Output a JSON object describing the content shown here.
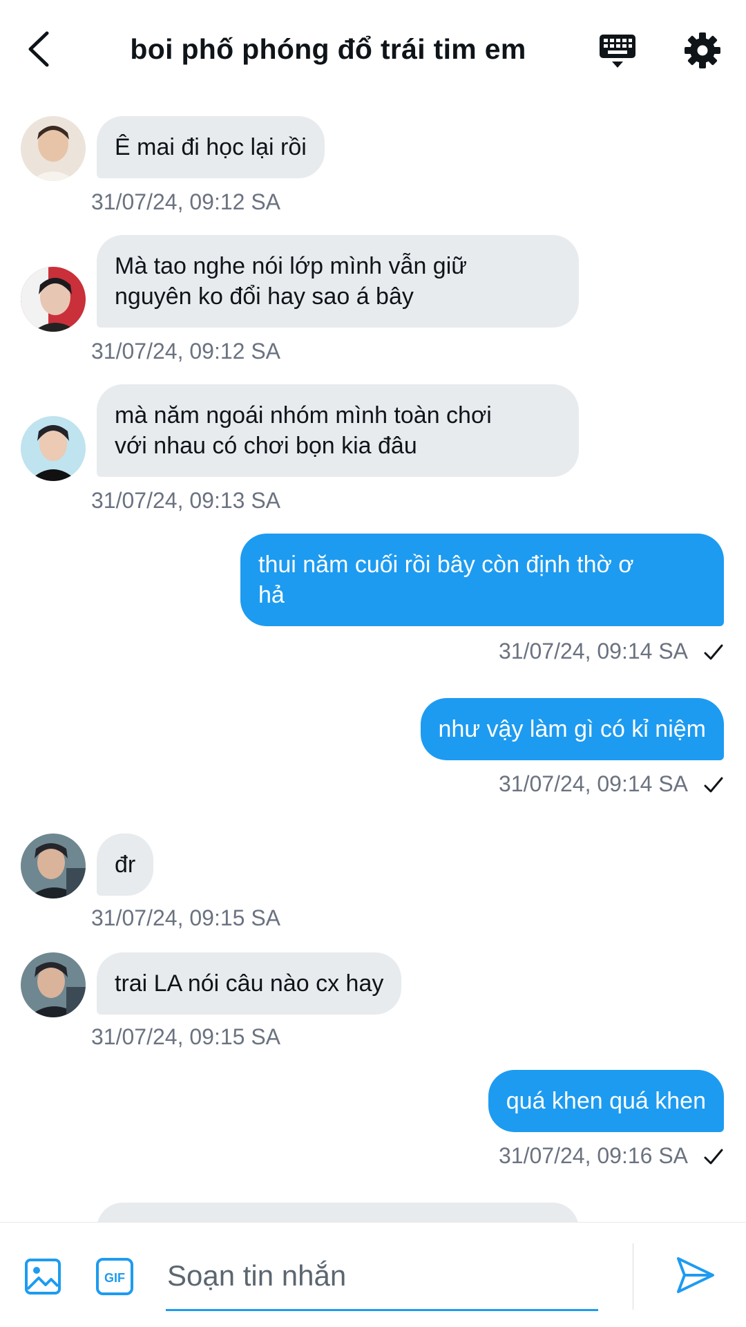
{
  "header": {
    "title": "boi phố phóng đổ trái tim em"
  },
  "icons": {
    "back": "chevron-left-icon",
    "keyboard": "keyboard-icon",
    "settings": "gear-icon",
    "image": "image-icon",
    "gif": "gif-icon",
    "send": "send-icon",
    "read_receipt": "checkmark-icon"
  },
  "colors": {
    "accent": "#1d9bf0",
    "incoming_bubble": "#e8ebee",
    "timestamp": "#6b7280"
  },
  "messages": [
    {
      "direction": "in",
      "lines": [
        "Ê mai đi học lại rồi"
      ],
      "time": "31/07/24, 09:12 SA"
    },
    {
      "direction": "in",
      "lines": [
        "Mà tao nghe nói lớp mình vẫn giữ",
        "nguyên ko đổi hay sao á bây"
      ],
      "time": "31/07/24, 09:12 SA"
    },
    {
      "direction": "in",
      "lines": [
        "mà năm ngoái nhóm mình toàn chơi",
        "với nhau có chơi bọn kia đâu"
      ],
      "time": "31/07/24, 09:13 SA"
    },
    {
      "direction": "out",
      "lines": [
        "thui năm cuối rồi bây còn định thờ ơ",
        "hả"
      ],
      "time": "31/07/24, 09:14 SA"
    },
    {
      "direction": "out",
      "lines": [
        "như vậy làm gì có kỉ niệm"
      ],
      "time": "31/07/24, 09:14 SA"
    },
    {
      "direction": "in",
      "lines": [
        "đr"
      ],
      "time": "31/07/24, 09:15 SA"
    },
    {
      "direction": "in",
      "lines": [
        "trai LA nói câu nào cx hay"
      ],
      "time": "31/07/24, 09:15 SA"
    },
    {
      "direction": "out",
      "lines": [
        "quá khen quá khen"
      ],
      "time": "31/07/24, 09:16 SA"
    }
  ],
  "composer": {
    "placeholder": "Soạn tin nhắn",
    "gif_label": "GIF"
  }
}
